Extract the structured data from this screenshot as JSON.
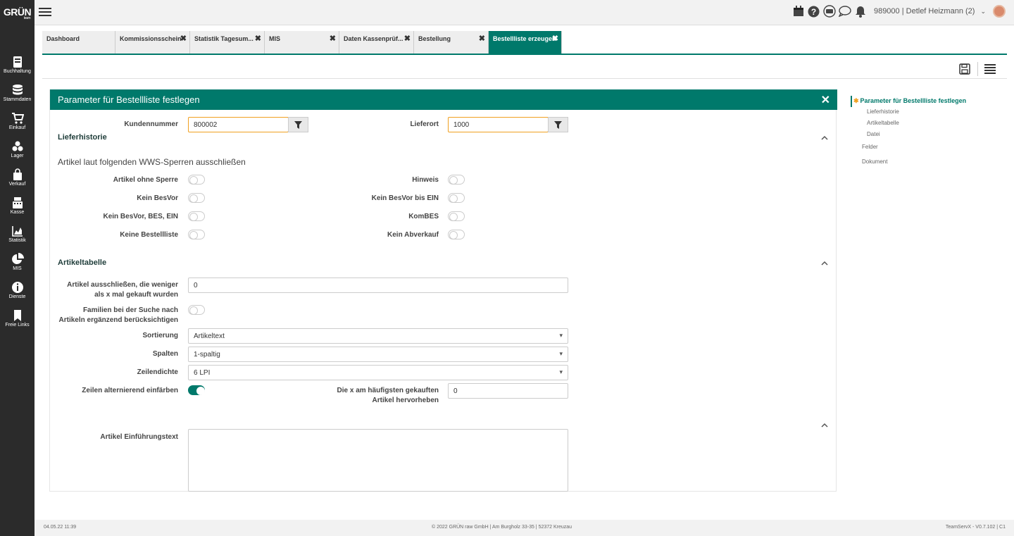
{
  "app": {
    "logo_text": "GRÜN",
    "logo_sub": "team"
  },
  "sidebar": {
    "items": [
      {
        "label": "Buchhaltung",
        "icon": "book-icon"
      },
      {
        "label": "Stammdaten",
        "icon": "database-icon"
      },
      {
        "label": "Einkauf",
        "icon": "cart-icon"
      },
      {
        "label": "Lager",
        "icon": "boxes-icon"
      },
      {
        "label": "Verkauf",
        "icon": "bag-icon"
      },
      {
        "label": "Kasse",
        "icon": "cash-register-icon"
      },
      {
        "label": "Statistik",
        "icon": "area-chart-icon"
      },
      {
        "label": "MIS",
        "icon": "pie-chart-icon"
      },
      {
        "label": "Dienste",
        "icon": "info-icon"
      },
      {
        "label": "Freie Links",
        "icon": "bookmark-icon"
      }
    ]
  },
  "topbar": {
    "user": "989000 | Detlef Heizmann (2)"
  },
  "tabs": [
    {
      "label": "Dashboard",
      "closable": false
    },
    {
      "label": "Kommissionsschein",
      "closable": true
    },
    {
      "label": "Statistik Tagesum...",
      "closable": true
    },
    {
      "label": "MIS",
      "closable": true
    },
    {
      "label": "Daten Kassenprüf...",
      "closable": true
    },
    {
      "label": "Bestellung",
      "closable": true
    },
    {
      "label": "Bestellliste erzeugen",
      "closable": true,
      "active": true
    }
  ],
  "panel": {
    "title": "Parameter für Bestellliste festlegen",
    "kundennummer": {
      "label": "Kundennummer",
      "value": "800002"
    },
    "lieferort": {
      "label": "Lieferort",
      "value": "1000"
    },
    "lieferhistorie": {
      "title": "Lieferhistorie",
      "subtitle": "Artikel laut folgenden WWS-Sperren ausschließen",
      "left": [
        {
          "label": "Artikel ohne Sperre",
          "on": false
        },
        {
          "label": "Kein BesVor",
          "on": false
        },
        {
          "label": "Kein BesVor, BES, EIN",
          "on": false
        },
        {
          "label": "Keine Bestellliste",
          "on": false
        }
      ],
      "right": [
        {
          "label": "Hinweis",
          "on": false
        },
        {
          "label": "Kein BesVor bis EIN",
          "on": false
        },
        {
          "label": "KomBES",
          "on": false
        },
        {
          "label": "Kein Abverkauf",
          "on": false
        }
      ]
    },
    "artikeltabelle": {
      "title": "Artikeltabelle",
      "exclude_label_1": "Artikel ausschließen, die weniger",
      "exclude_label_2": "als x mal gekauft wurden",
      "exclude_value": "0",
      "familien_label_1": "Familien bei der Suche nach",
      "familien_label_2": "Artikeln ergänzend berücksichtigen",
      "familien_on": false,
      "sortierung_label": "Sortierung",
      "sortierung_value": "Artikeltext",
      "spalten_label": "Spalten",
      "spalten_value": "1-spaltig",
      "zeilendichte_label": "Zeilendichte",
      "zeilendichte_value": "6 LPI",
      "alternierend_label": "Zeilen alternierend einfärben",
      "alternierend_on": true,
      "hervorheben_label_1": "Die x am häufigsten gekauften",
      "hervorheben_label_2": "Artikel hervorheben",
      "hervorheben_value": "0"
    },
    "datei": {
      "einfuehrung_label": "Artikel Einführungstext",
      "einfuehrung_value": ""
    }
  },
  "nav": {
    "main": "Parameter für Bestellliste festlegen",
    "subs": [
      "Lieferhistorie",
      "Artikeltabelle",
      "Datei"
    ],
    "items": [
      "Felder",
      "Dokument"
    ]
  },
  "footer": {
    "left": "04.05.22 11:39",
    "center": "© 2022 GRÜN raw GmbH | Am Burgholz 33-35 | 52372 Kreuzau",
    "right": "TeamServX - V0.7.102 | C1"
  },
  "colors": {
    "accent": "#00796b",
    "highlight": "#f0a020",
    "sidebar": "#2b2b2b"
  }
}
